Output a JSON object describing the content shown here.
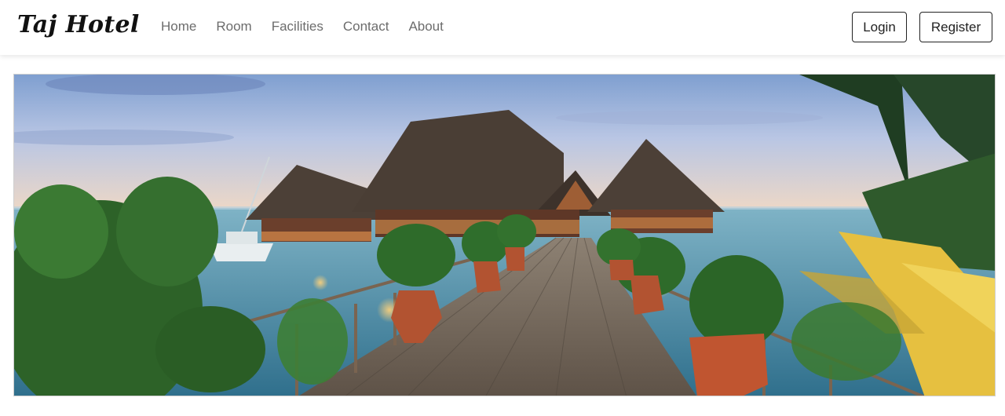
{
  "navbar": {
    "brand": "Taj Hotel",
    "links": [
      {
        "label": "Home"
      },
      {
        "label": "Room"
      },
      {
        "label": "Facilities"
      },
      {
        "label": "Contact"
      },
      {
        "label": "About"
      }
    ],
    "login_label": "Login",
    "register_label": "Register"
  },
  "hero": {
    "image_alt": "overwater resort boardwalk with thatched bungalows at dusk"
  },
  "colors": {
    "sky_top": "#7f9fd0",
    "sky_horizon": "#f1d9c4",
    "sea": "#4e8fae",
    "deck": "#7a6e62",
    "thatch": "#4c4037",
    "pot": "#b25331",
    "foliage": "#2e6b2a",
    "palm_yellow": "#e6c040"
  }
}
